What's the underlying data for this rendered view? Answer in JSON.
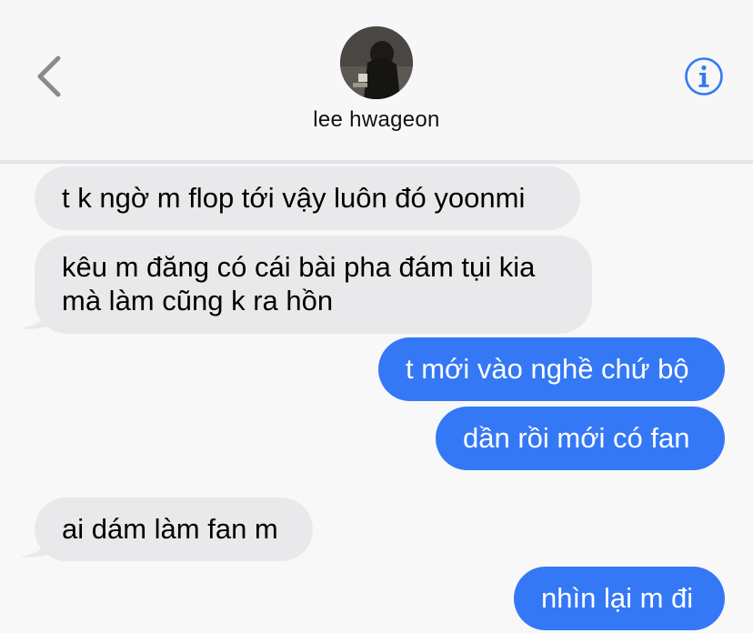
{
  "header": {
    "back_icon": "chevron-left-icon",
    "contact_name": "lee hwageon",
    "info_icon": "info-circle-icon"
  },
  "colors": {
    "header_bg": "#f7f7f7",
    "incoming_bubble": "#e9e9eb",
    "outgoing_bubble": "#3478f6",
    "accent": "#3478f6"
  },
  "messages": [
    {
      "direction": "incoming",
      "text": "t k ngờ m flop tới vậy luôn đó yoonmi"
    },
    {
      "direction": "incoming",
      "line1": "kêu m đăng có cái bài pha đám tụi kia",
      "line2": "mà làm cũng k ra hồn"
    },
    {
      "direction": "outgoing",
      "text": "t mới vào nghề chứ bộ"
    },
    {
      "direction": "outgoing",
      "text": "dần rồi mới có fan"
    },
    {
      "direction": "incoming",
      "text": "ai dám làm fan m"
    },
    {
      "direction": "outgoing",
      "text": "nhìn lại m đi"
    }
  ]
}
